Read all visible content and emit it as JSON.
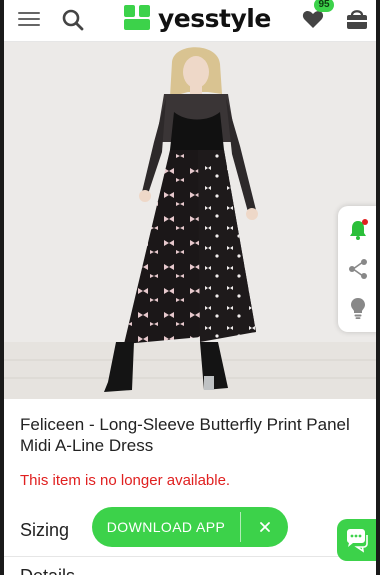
{
  "header": {
    "logo_text": "yesstyle",
    "wishlist_count": "95",
    "icons": [
      "menu-icon",
      "search-icon",
      "heart-icon",
      "bag-icon"
    ]
  },
  "product": {
    "title": "Feliceen - Long-Sleeve Butterfly Print Panel Midi A-Line Dress",
    "availability": "This item is no longer available.",
    "sizing_label": "Sizing",
    "details_label": "Details"
  },
  "side_tools": {
    "icons": [
      "bell-icon",
      "share-icon",
      "lightbulb-icon"
    ]
  },
  "app_banner": {
    "download_label": "DOWNLOAD APP",
    "close_glyph": "×"
  },
  "colors": {
    "brand_green": "#3cd24a",
    "alert_red": "#e02020"
  }
}
